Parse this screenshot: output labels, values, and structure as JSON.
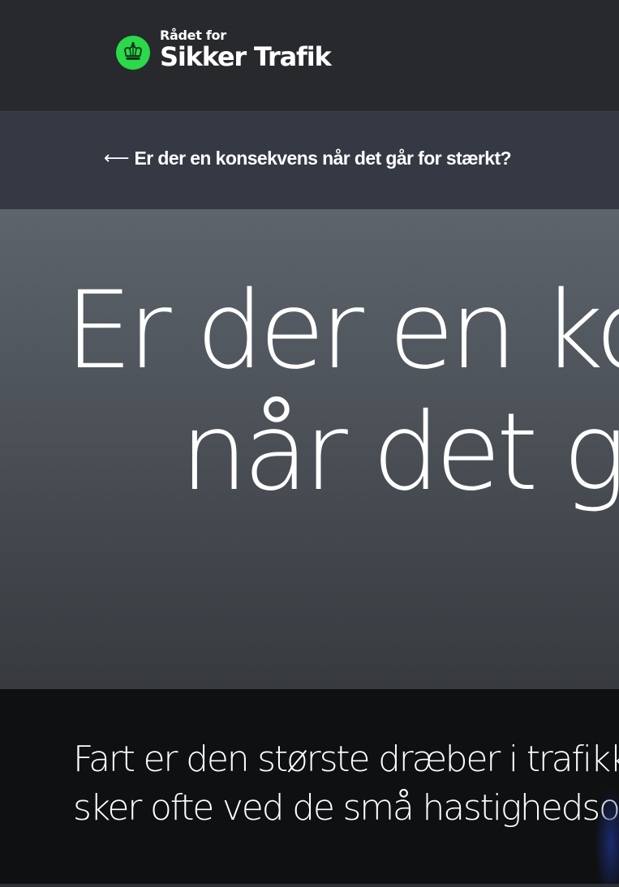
{
  "header": {
    "logo_line1": "Rådet for",
    "logo_line2": "Sikker Trafik",
    "logo_color": "#2bd94a"
  },
  "breadcrumb": {
    "icon": "arrow-left-icon",
    "label": "Er der en konsekvens når det går for stærkt?"
  },
  "hero": {
    "title_line1": "Er der en konsekvens",
    "title_line2": "når det går for stærkt?"
  },
  "intro": {
    "line1": "Fart er den største dræber i trafikken, og ulykker",
    "line2": "sker ofte ved de små hastighedsoverskridelser."
  },
  "colors": {
    "header_bg": "#27292d",
    "breadcrumb_bg": "#343943",
    "intro_bg": "#0f1012"
  }
}
